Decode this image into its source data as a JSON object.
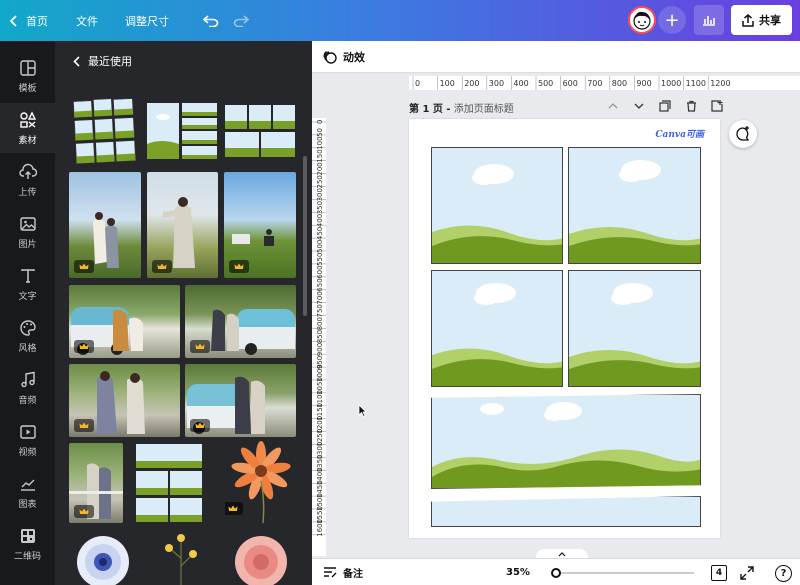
{
  "topbar": {
    "home_label": "首页",
    "file_label": "文件",
    "resize_label": "调整尺寸",
    "share_label": "共享"
  },
  "rail": {
    "items": [
      {
        "label": "模板",
        "icon": "template-icon"
      },
      {
        "label": "素材",
        "icon": "elements-icon"
      },
      {
        "label": "上传",
        "icon": "upload-icon"
      },
      {
        "label": "图片",
        "icon": "photo-icon"
      },
      {
        "label": "文字",
        "icon": "text-icon"
      },
      {
        "label": "风格",
        "icon": "palette-icon"
      },
      {
        "label": "音频",
        "icon": "music-icon"
      },
      {
        "label": "视频",
        "icon": "video-icon"
      },
      {
        "label": "图表",
        "icon": "chart-icon"
      },
      {
        "label": "二维码",
        "icon": "qrcode-icon"
      }
    ]
  },
  "panel": {
    "title": "最近使用"
  },
  "editor": {
    "animate_label": "动效",
    "ruler_ticks": [
      "0",
      "100",
      "200",
      "300",
      "400",
      "500",
      "600",
      "700",
      "800",
      "900",
      "1000",
      "1100",
      "1200"
    ],
    "ruler_left_ticks": [
      "0",
      "50",
      "100",
      "150",
      "200",
      "250",
      "300",
      "350",
      "400",
      "450",
      "500",
      "550",
      "600",
      "650",
      "700",
      "750",
      "800",
      "850",
      "900",
      "950",
      "1000",
      "1050",
      "1100",
      "1150",
      "1200",
      "1250",
      "1300",
      "1350",
      "1400",
      "1450",
      "1500",
      "1550",
      "1600"
    ],
    "page_label": "第 1 页 -",
    "page_title_placeholder": "添加页面标题",
    "logo_text": "Canva可画"
  },
  "bottombar": {
    "notes_label": "备注",
    "zoom": "35%",
    "page_count": "4",
    "help": "?"
  },
  "colors": {
    "sky": "#d9ecf7",
    "grass_dark": "#6f9a1f",
    "grass_light": "#b2d06a",
    "brand_gradient_start": "#12a8c9",
    "brand_gradient_end": "#6a3fe0"
  }
}
